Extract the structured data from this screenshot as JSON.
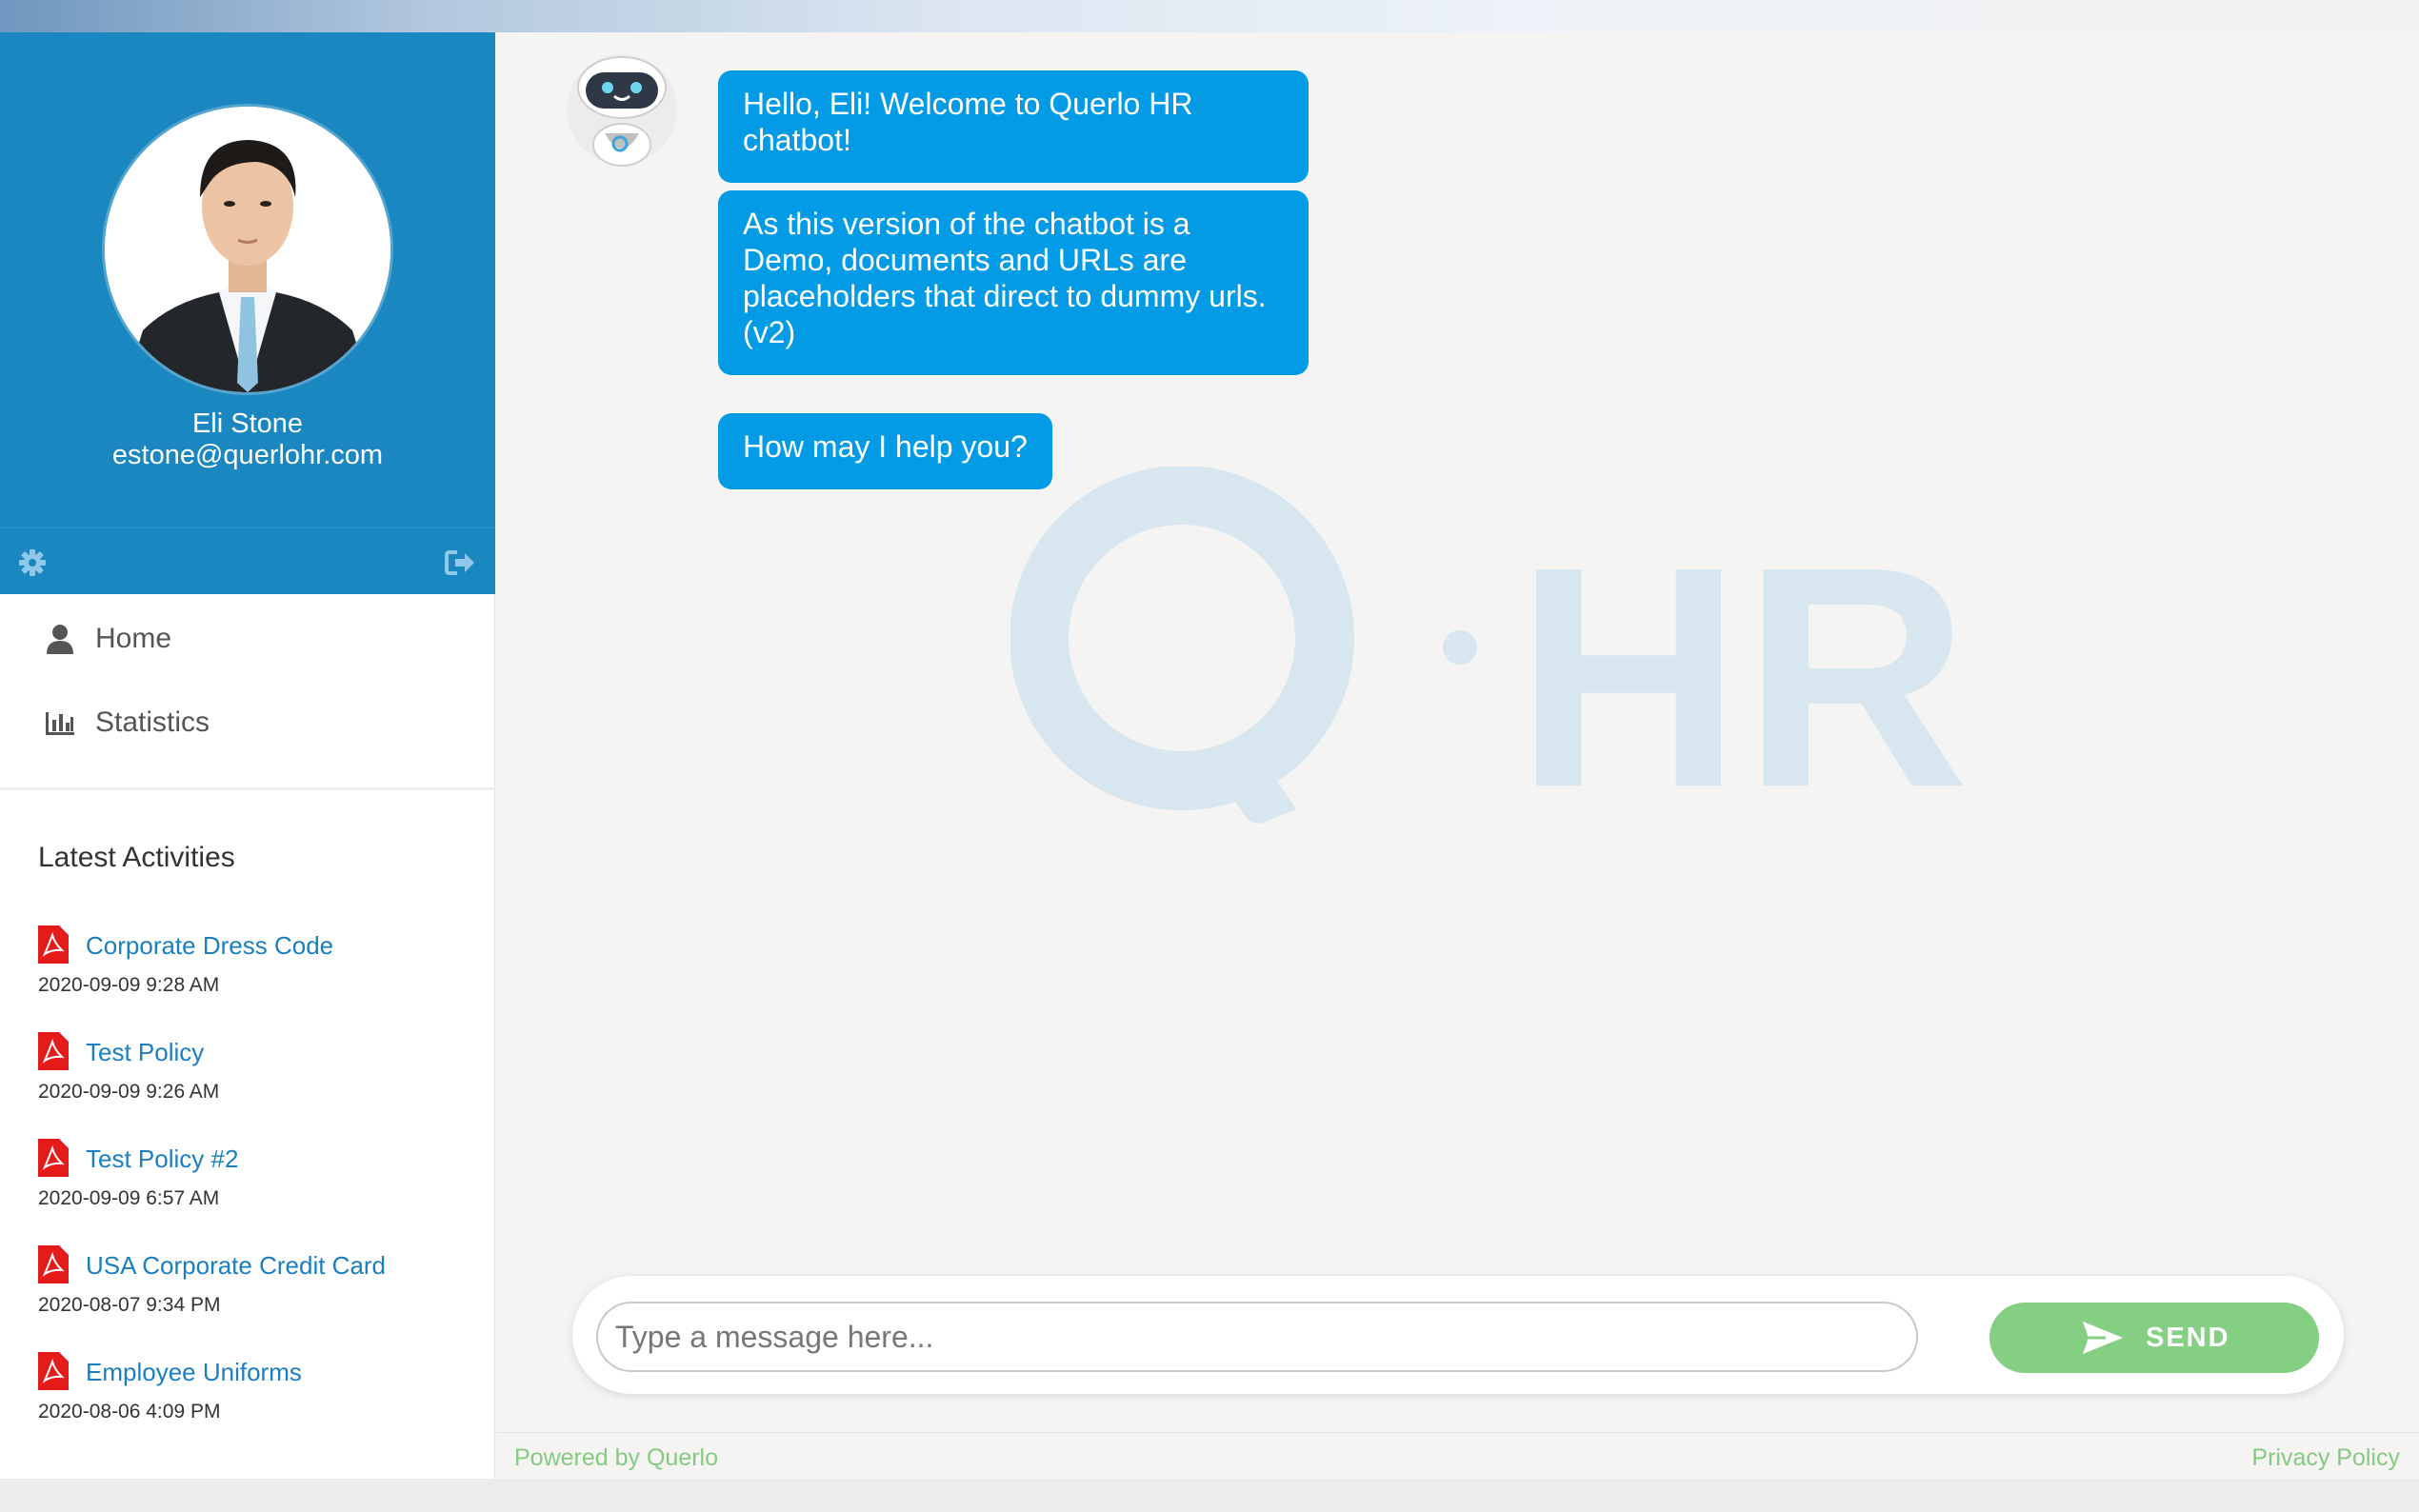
{
  "user": {
    "name": "Eli Stone",
    "email": "estone@querlohr.com"
  },
  "nav": {
    "items": [
      {
        "label": "Home",
        "icon": "user-icon"
      },
      {
        "label": "Statistics",
        "icon": "bar-chart-icon"
      }
    ]
  },
  "activities": {
    "title": "Latest Activities",
    "items": [
      {
        "label": "Corporate Dress Code",
        "date": "2020-09-09 9:28 AM",
        "icon": "pdf-icon"
      },
      {
        "label": "Test Policy",
        "date": "2020-09-09 9:26 AM",
        "icon": "pdf-icon"
      },
      {
        "label": "Test Policy #2",
        "date": "2020-09-09 6:57 AM",
        "icon": "pdf-icon"
      },
      {
        "label": "USA Corporate Credit Card",
        "date": "2020-08-07 9:34 PM",
        "icon": "pdf-icon"
      },
      {
        "label": "Employee Uniforms",
        "date": "2020-08-06 4:09 PM",
        "icon": "pdf-icon"
      }
    ]
  },
  "chat": {
    "messages": [
      "Hello, Eli! Welcome to Querlo HR chatbot!",
      "As this version of the chatbot is a Demo, documents and URLs are placeholders that direct to dummy urls. (v2)",
      "How may I help you?"
    ],
    "watermark_letter": "Q",
    "watermark_text": "HR"
  },
  "composer": {
    "placeholder": "Type a message here...",
    "send_label": "SEND"
  },
  "footer": {
    "powered": "Powered by Querlo",
    "privacy": "Privacy Policy"
  },
  "colors": {
    "sidebar_blue": "#1a87c0",
    "bubble_blue": "#039be5",
    "send_green": "#85cf82",
    "link_blue": "#1a7fbf",
    "pdf_red": "#e51b1b"
  }
}
